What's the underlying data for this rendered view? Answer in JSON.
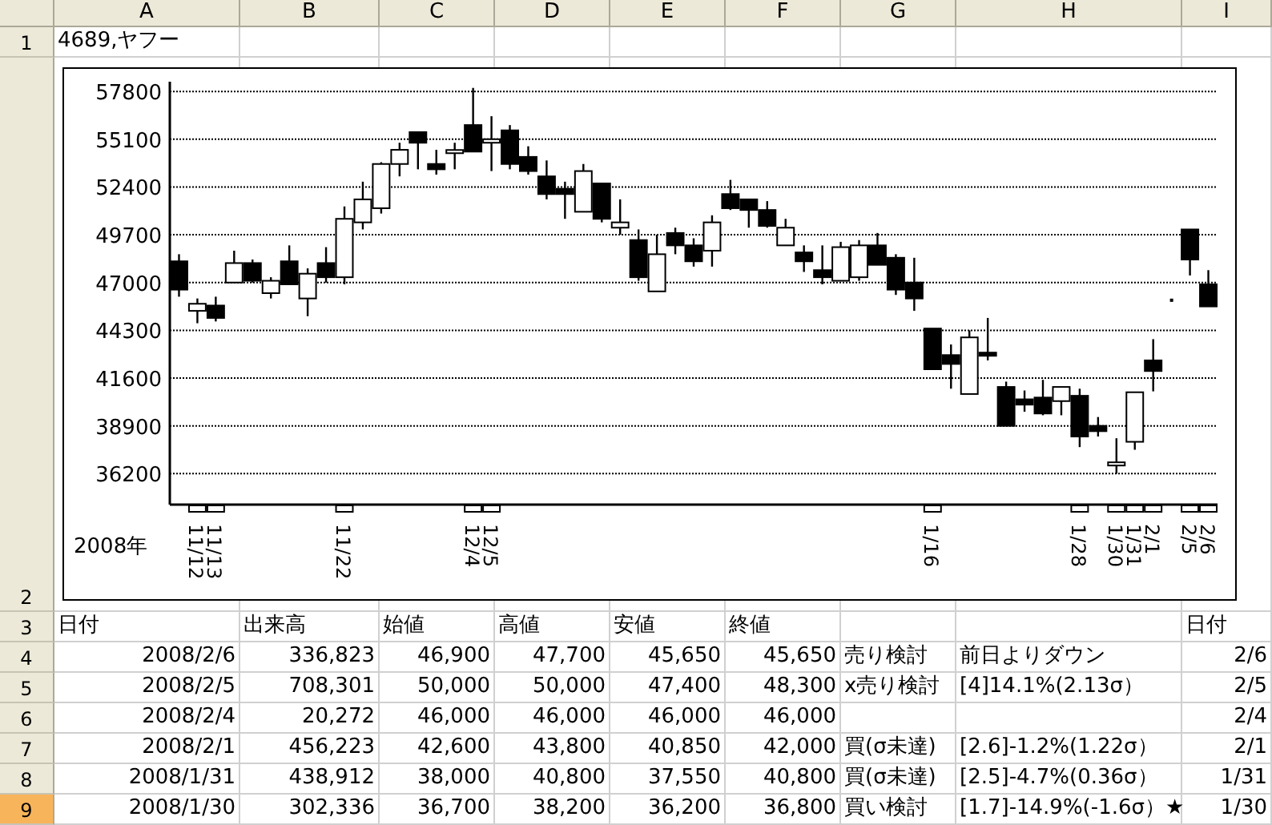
{
  "sheet": {
    "columns": [
      {
        "label": "A",
        "selected": false
      },
      {
        "label": "B",
        "selected": false
      },
      {
        "label": "C",
        "selected": false
      },
      {
        "label": "D",
        "selected": false
      },
      {
        "label": "E",
        "selected": false
      },
      {
        "label": "F",
        "selected": false
      },
      {
        "label": "G",
        "selected": false
      },
      {
        "label": "H",
        "selected": false
      },
      {
        "label": "I",
        "selected": false
      }
    ],
    "rows": [
      {
        "header": "1",
        "selected": false,
        "cells": [
          {
            "kind": "text",
            "text": "4689,ヤフー"
          },
          null,
          null,
          null,
          null,
          null,
          null,
          null,
          null
        ]
      },
      {
        "header": "2",
        "selected": false,
        "chart": {
          "year_label": "2008年",
          "chart_data": {
            "type": "candlestick",
            "grid": true,
            "ylim": [
              34450,
              58350
            ],
            "yticks": [
              36200,
              38900,
              41600,
              44300,
              47000,
              49700,
              52400,
              55100,
              57800
            ],
            "categories": [
              null,
              "11/12",
              "11/13",
              null,
              null,
              null,
              null,
              null,
              null,
              "11/22",
              null,
              null,
              null,
              null,
              null,
              null,
              "12/4",
              "12/5",
              null,
              null,
              null,
              null,
              null,
              null,
              null,
              null,
              null,
              null,
              null,
              null,
              null,
              null,
              null,
              null,
              null,
              null,
              null,
              null,
              null,
              null,
              null,
              "1/16",
              null,
              null,
              null,
              null,
              null,
              null,
              null,
              "1/28",
              null,
              "1/30",
              "1/31",
              "2/1",
              null,
              "2/5",
              "2/6"
            ],
            "ohlc": [
              [
                48200,
                48600,
                46200,
                46600
              ],
              [
                45400,
                46100,
                44700,
                45800
              ],
              [
                45700,
                46200,
                44800,
                45000
              ],
              [
                47000,
                48800,
                47000,
                48100
              ],
              [
                48100,
                48300,
                47000,
                47100
              ],
              [
                46400,
                47300,
                46100,
                47100
              ],
              [
                48200,
                49100,
                46900,
                46900
              ],
              [
                46100,
                47800,
                45100,
                47500
              ],
              [
                48100,
                49000,
                47000,
                47300
              ],
              [
                47300,
                51300,
                46900,
                50600
              ],
              [
                50400,
                52700,
                50000,
                51700
              ],
              [
                51200,
                53800,
                50900,
                53700
              ],
              [
                53700,
                54900,
                53000,
                54500
              ],
              [
                55500,
                55500,
                53400,
                54900
              ],
              [
                53700,
                54500,
                53100,
                53400
              ],
              [
                54400,
                54900,
                53400,
                54400
              ],
              [
                55900,
                58000,
                54400,
                54400
              ],
              [
                54900,
                56400,
                53300,
                55100
              ],
              [
                55600,
                55900,
                53400,
                53700
              ],
              [
                54100,
                54700,
                53100,
                53300
              ],
              [
                53000,
                53900,
                51700,
                52000
              ],
              [
                52300,
                52700,
                50600,
                52000
              ],
              [
                51000,
                53700,
                51000,
                53300
              ],
              [
                52600,
                52600,
                50400,
                50600
              ],
              [
                50100,
                51700,
                49700,
                50400
              ],
              [
                49400,
                50000,
                47100,
                47300
              ],
              [
                46500,
                49700,
                46500,
                48600
              ],
              [
                49800,
                50100,
                48600,
                49100
              ],
              [
                49100,
                49500,
                47900,
                48200
              ],
              [
                48800,
                50800,
                47900,
                50400
              ],
              [
                52000,
                52800,
                51100,
                51200
              ],
              [
                51700,
                51700,
                50100,
                51100
              ],
              [
                51100,
                51600,
                50100,
                50200
              ],
              [
                49100,
                50600,
                49100,
                50100
              ],
              [
                48700,
                49100,
                47600,
                48200
              ],
              [
                47700,
                49100,
                46900,
                47300
              ],
              [
                47100,
                49300,
                47100,
                49000
              ],
              [
                47300,
                49400,
                47100,
                49100
              ],
              [
                49100,
                49800,
                48000,
                48000
              ],
              [
                48400,
                48600,
                46300,
                46600
              ],
              [
                47000,
                48400,
                45400,
                46100
              ],
              [
                44400,
                44400,
                42100,
                42100
              ],
              [
                42900,
                43500,
                41000,
                42400
              ],
              [
                40700,
                44300,
                40700,
                43900
              ],
              [
                43000,
                45000,
                42600,
                42900
              ],
              [
                41100,
                41400,
                38900,
                38900
              ],
              [
                40400,
                40900,
                39700,
                40100
              ],
              [
                40500,
                41500,
                39500,
                39600
              ],
              [
                40300,
                41100,
                39500,
                41100
              ],
              [
                40600,
                41000,
                37700,
                38300
              ],
              [
                38900,
                39400,
                38300,
                38600
              ],
              [
                36700,
                38200,
                36200,
                36800
              ],
              [
                38000,
                40800,
                37550,
                40800
              ],
              [
                42600,
                43800,
                40850,
                42000
              ],
              [
                46000,
                46000,
                46000,
                46000
              ],
              [
                50000,
                50000,
                47400,
                48300
              ],
              [
                46900,
                47700,
                45650,
                45650
              ]
            ]
          }
        }
      },
      {
        "header": "3",
        "selected": false,
        "cells": [
          {
            "kind": "text",
            "text": "日付"
          },
          {
            "kind": "text",
            "text": "出来高"
          },
          {
            "kind": "text",
            "text": "始値"
          },
          {
            "kind": "text",
            "text": "高値"
          },
          {
            "kind": "text",
            "text": "安値"
          },
          {
            "kind": "text",
            "text": "終値"
          },
          null,
          null,
          {
            "kind": "text",
            "text": "日付"
          }
        ]
      },
      {
        "header": "4",
        "selected": false,
        "cells": [
          {
            "kind": "number",
            "text": "2008/2/6"
          },
          {
            "kind": "number",
            "text": "336,823"
          },
          {
            "kind": "number",
            "text": "46,900"
          },
          {
            "kind": "number",
            "text": "47,700"
          },
          {
            "kind": "number",
            "text": "45,650"
          },
          {
            "kind": "number",
            "text": "45,650"
          },
          {
            "kind": "text",
            "text": "売り検討"
          },
          {
            "kind": "text",
            "text": "前日よりダウン"
          },
          {
            "kind": "number",
            "text": "2/6"
          }
        ]
      },
      {
        "header": "5",
        "selected": false,
        "cells": [
          {
            "kind": "number",
            "text": "2008/2/5"
          },
          {
            "kind": "number",
            "text": "708,301"
          },
          {
            "kind": "number",
            "text": "50,000"
          },
          {
            "kind": "number",
            "text": "50,000"
          },
          {
            "kind": "number",
            "text": "47,400"
          },
          {
            "kind": "number",
            "text": "48,300"
          },
          {
            "kind": "text",
            "text": "x売り検討"
          },
          {
            "kind": "text",
            "text": "[4]14.1%(2.13σ）"
          },
          {
            "kind": "number",
            "text": "2/5"
          }
        ]
      },
      {
        "header": "6",
        "selected": false,
        "cells": [
          {
            "kind": "number",
            "text": "2008/2/4"
          },
          {
            "kind": "number",
            "text": "20,272"
          },
          {
            "kind": "number",
            "text": "46,000"
          },
          {
            "kind": "number",
            "text": "46,000"
          },
          {
            "kind": "number",
            "text": "46,000"
          },
          {
            "kind": "number",
            "text": "46,000"
          },
          null,
          null,
          {
            "kind": "number",
            "text": "2/4"
          }
        ]
      },
      {
        "header": "7",
        "selected": false,
        "cells": [
          {
            "kind": "number",
            "text": "2008/2/1"
          },
          {
            "kind": "number",
            "text": "456,223"
          },
          {
            "kind": "number",
            "text": "42,600"
          },
          {
            "kind": "number",
            "text": "43,800"
          },
          {
            "kind": "number",
            "text": "40,850"
          },
          {
            "kind": "number",
            "text": "42,000"
          },
          {
            "kind": "text",
            "text": "買(σ未達)"
          },
          {
            "kind": "text",
            "text": "[2.6]-1.2%(1.22σ）"
          },
          {
            "kind": "number",
            "text": "2/1"
          }
        ]
      },
      {
        "header": "8",
        "selected": false,
        "cells": [
          {
            "kind": "number",
            "text": "2008/1/31"
          },
          {
            "kind": "number",
            "text": "438,912"
          },
          {
            "kind": "number",
            "text": "38,000"
          },
          {
            "kind": "number",
            "text": "40,800"
          },
          {
            "kind": "number",
            "text": "37,550"
          },
          {
            "kind": "number",
            "text": "40,800"
          },
          {
            "kind": "text",
            "text": "買(σ未達)"
          },
          {
            "kind": "text",
            "text": "[2.5]-4.7%(0.36σ）"
          },
          {
            "kind": "number",
            "text": "1/31"
          }
        ]
      },
      {
        "header": "9",
        "selected": true,
        "cells": [
          {
            "kind": "number",
            "text": "2008/1/30"
          },
          {
            "kind": "number",
            "text": "302,336"
          },
          {
            "kind": "number",
            "text": "36,700"
          },
          {
            "kind": "number",
            "text": "38,200"
          },
          {
            "kind": "number",
            "text": "36,200"
          },
          {
            "kind": "number",
            "text": "36,800"
          },
          {
            "kind": "text",
            "text": "買い検討"
          },
          {
            "kind": "text",
            "text": "[1.7]-14.9%(-1.6σ）★"
          },
          {
            "kind": "number",
            "text": "1/30"
          }
        ]
      }
    ]
  }
}
